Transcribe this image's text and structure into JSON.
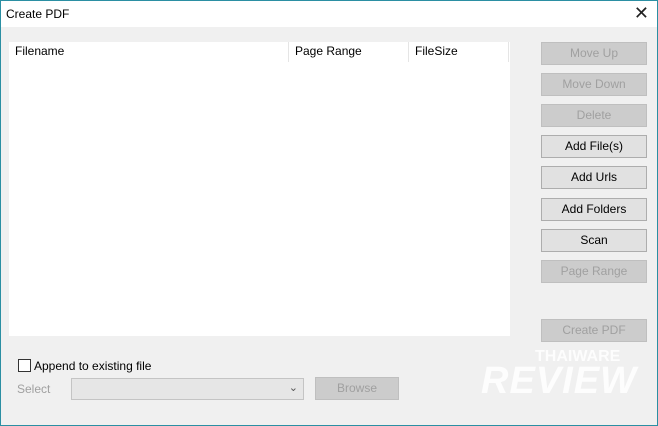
{
  "window": {
    "title": "Create PDF",
    "close_icon": "close-icon"
  },
  "list": {
    "columns": [
      "Filename",
      "Page Range",
      "FileSize"
    ],
    "rows": []
  },
  "buttons": {
    "move_up": "Move Up",
    "move_down": "Move Down",
    "delete": "Delete",
    "add_files": "Add File(s)",
    "add_urls": "Add Urls",
    "add_folders": "Add Folders",
    "scan": "Scan",
    "page_range": "Page Range",
    "create_pdf": "Create PDF"
  },
  "append": {
    "label": "Append to existing file",
    "checked": false
  },
  "select": {
    "label": "Select",
    "value": "",
    "browse": "Browse"
  },
  "watermark": {
    "top": "THAIWARE",
    "main": "REVIEW"
  }
}
